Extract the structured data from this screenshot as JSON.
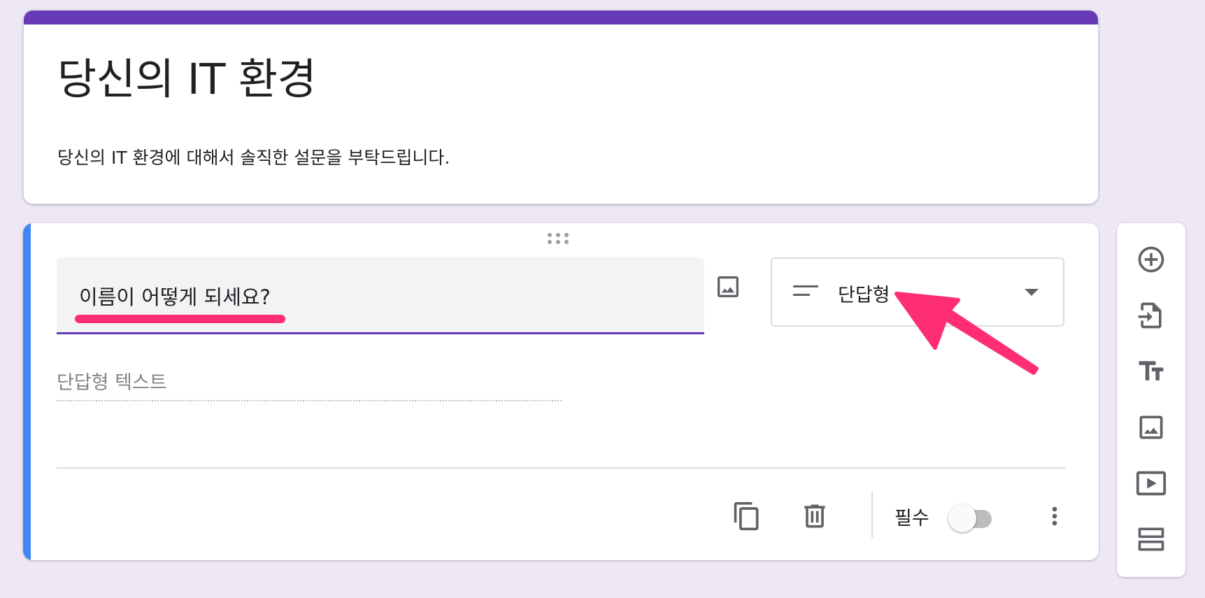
{
  "form": {
    "title": "당신의 IT 환경",
    "description": "당신의 IT 환경에 대해서 솔직한 설문을 부탁드립니다."
  },
  "question": {
    "text": "이름이 어떻게 되세요?",
    "type_label": "단답형",
    "answer_placeholder": "단답형 텍스트",
    "required_label": "필수",
    "required_on": false
  },
  "colors": {
    "theme": "#673ab7",
    "active_bar": "#4285f4",
    "background": "#ede7f6",
    "annotation": "#ff2d73"
  },
  "icons": {
    "question_image": "image-icon",
    "type": "short-answer-icon",
    "duplicate": "copy-icon",
    "delete": "trash-icon",
    "more": "more-vert-icon",
    "toolbar": [
      "add-circle-icon",
      "import-icon",
      "title-text-icon",
      "image-icon",
      "video-icon",
      "section-icon"
    ]
  }
}
